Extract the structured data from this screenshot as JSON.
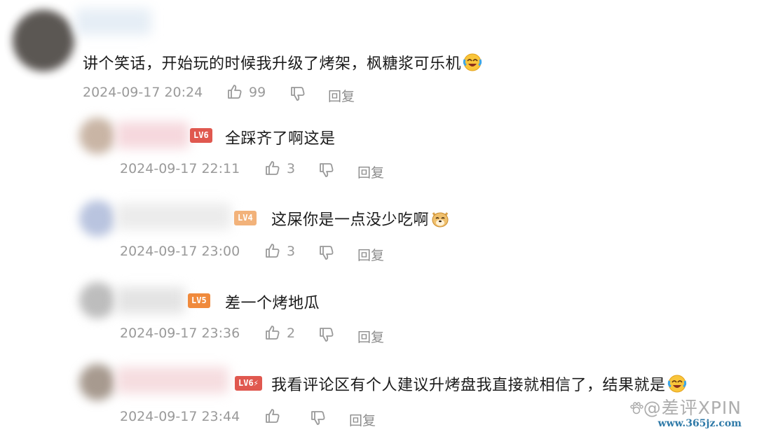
{
  "main_comment": {
    "text": "讲个笑话，开始玩的时候我升级了烤架，枫糖浆可乐机",
    "emoji": "crying-laughing-emoji",
    "time": "2024-09-17 20:24",
    "likes": "99",
    "reply_label": "回复"
  },
  "replies": [
    {
      "level": "LV6",
      "badge_color": "#e0584f",
      "text": "全踩齐了啊这是",
      "time": "2024-09-17 22:11",
      "likes": "3",
      "reply_label": "回复"
    },
    {
      "level": "LV4",
      "badge_color": "#f2b27a",
      "text": "这屎你是一点没少吃啊",
      "emoji": "doge-emoji",
      "time": "2024-09-17 23:00",
      "likes": "3",
      "reply_label": "回复"
    },
    {
      "level": "LV5",
      "badge_color": "#f08a3c",
      "text": "差一个烤地瓜",
      "time": "2024-09-17 23:36",
      "likes": "2",
      "reply_label": "回复"
    },
    {
      "level": "LV6⚡",
      "badge_color": "#e0584f",
      "text": "我看评论区有个人建议升烤盘我直接就相信了，结果就是",
      "emoji": "crying-laughing-emoji",
      "time": "2024-09-17 23:44",
      "likes": "",
      "reply_label": "回复"
    }
  ],
  "watermark": {
    "main": "@差评XPIN",
    "url": "www.365jz.com"
  }
}
